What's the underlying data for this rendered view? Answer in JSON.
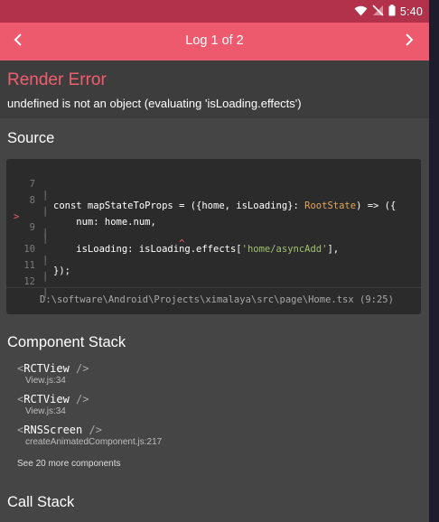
{
  "status_bar": {
    "time": "5:40",
    "icons": [
      "wifi-icon",
      "signal-off-icon",
      "battery-icon"
    ]
  },
  "header": {
    "title": "Log 1 of 2",
    "prev_icon": "chevron-left-icon",
    "next_icon": "chevron-right-icon"
  },
  "error": {
    "title": "Render Error",
    "message": "undefined is not an object (evaluating 'isLoading.effects')"
  },
  "source": {
    "title": "Source",
    "lines": [
      {
        "number": "7",
        "marker": "",
        "text": "const mapStateToProps = ({home, isLoading}: RootState) => ({"
      },
      {
        "number": "8",
        "marker": "",
        "text": "    num: home.num,"
      },
      {
        "number": "9",
        "marker": ">",
        "text": "    isLoading: isLoading.effects['home/asyncAdd'],"
      },
      {
        "number": "",
        "marker": "",
        "text": "                      ^"
      },
      {
        "number": "10",
        "marker": "",
        "text": "});"
      },
      {
        "number": "11",
        "marker": "",
        "text": ""
      },
      {
        "number": "12",
        "marker": "",
        "text": ""
      }
    ],
    "file": "D:\\software\\Android\\Projects\\ximalaya\\src\\page\\Home.tsx (9:25)"
  },
  "component_stack": {
    "title": "Component Stack",
    "frames": [
      {
        "name": "RCTView",
        "location": "View.js:34"
      },
      {
        "name": "RCTView",
        "location": "View.js:34"
      },
      {
        "name": "RNSScreen",
        "location": "createAnimatedComponent.js:217"
      }
    ],
    "see_more": "See 20 more components"
  },
  "call_stack": {
    "title": "Call Stack"
  },
  "colors": {
    "status_bar": "#b2324c",
    "header": "#ed5a6d",
    "error_title": "#f05f6f",
    "background": "#454545",
    "code_background": "#2b2b2b",
    "string": "#a1c171",
    "type": "#e2a65d"
  }
}
